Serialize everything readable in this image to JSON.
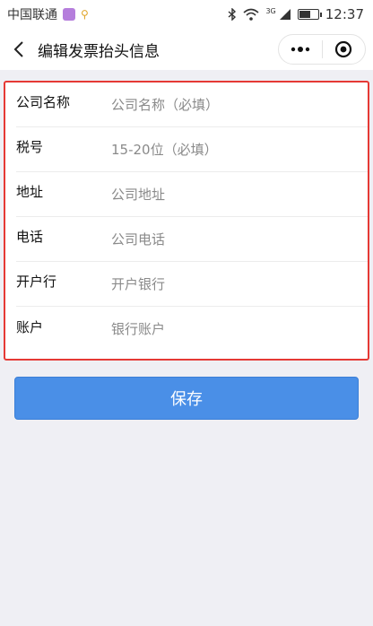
{
  "status_bar": {
    "carrier": "中国联通",
    "network_type": "3G",
    "time": "12:37",
    "battery_level": 0.6
  },
  "nav": {
    "title": "编辑发票抬头信息",
    "back_icon": "chevron-left-icon",
    "more_icon": "more-dots-icon",
    "close_icon": "target-circle-icon"
  },
  "form": {
    "fields": [
      {
        "label": "公司名称",
        "placeholder": "公司名称（必填）",
        "value": ""
      },
      {
        "label": "税号",
        "placeholder": "15-20位（必填）",
        "value": ""
      },
      {
        "label": "地址",
        "placeholder": "公司地址",
        "value": ""
      },
      {
        "label": "电话",
        "placeholder": "公司电话",
        "value": ""
      },
      {
        "label": "开户行",
        "placeholder": "开户银行",
        "value": ""
      },
      {
        "label": "账户",
        "placeholder": "银行账户",
        "value": ""
      }
    ]
  },
  "actions": {
    "save_label": "保存"
  },
  "colors": {
    "primary": "#4a8fe7",
    "highlight_border": "#e53935",
    "page_background": "#efeff4"
  }
}
